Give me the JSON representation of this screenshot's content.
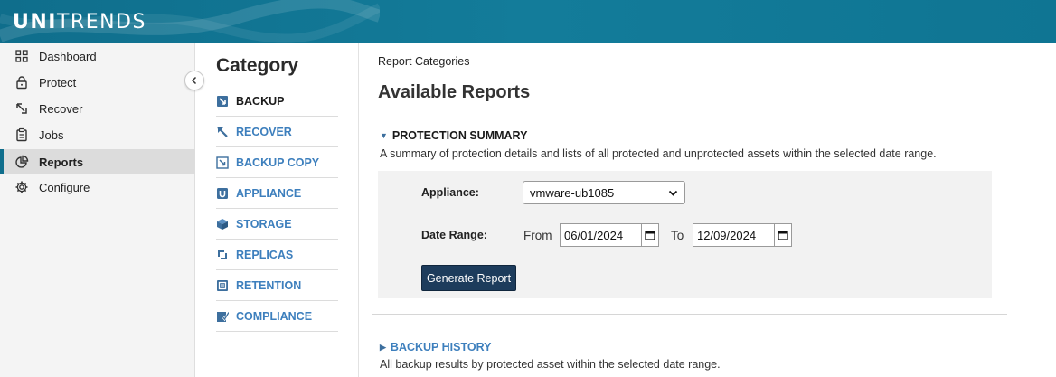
{
  "header": {
    "logo_strong": "UNI",
    "logo_rest": "TRENDS"
  },
  "sidebar": {
    "items": [
      {
        "label": "Dashboard",
        "icon": "dashboard-icon"
      },
      {
        "label": "Protect",
        "icon": "lock-icon"
      },
      {
        "label": "Recover",
        "icon": "recover-arrow-icon"
      },
      {
        "label": "Jobs",
        "icon": "clipboard-icon"
      },
      {
        "label": "Reports",
        "icon": "pie-chart-icon",
        "active": true
      },
      {
        "label": "Configure",
        "icon": "gear-icon"
      }
    ]
  },
  "category": {
    "title": "Category",
    "items": [
      {
        "label": "BACKUP",
        "icon": "backup-icon",
        "active": true
      },
      {
        "label": "RECOVER",
        "icon": "recover-icon"
      },
      {
        "label": "BACKUP COPY",
        "icon": "backup-copy-icon"
      },
      {
        "label": "APPLIANCE",
        "icon": "appliance-icon"
      },
      {
        "label": "STORAGE",
        "icon": "storage-cube-icon"
      },
      {
        "label": "REPLICAS",
        "icon": "replicas-icon"
      },
      {
        "label": "RETENTION",
        "icon": "retention-icon"
      },
      {
        "label": "COMPLIANCE",
        "icon": "compliance-icon"
      }
    ]
  },
  "main": {
    "breadcrumb": "Report Categories",
    "title": "Available Reports",
    "protection_summary": {
      "heading": "PROTECTION SUMMARY",
      "description": "A summary of protection details and lists of all protected and unprotected assets within the selected date range.",
      "appliance_label": "Appliance:",
      "appliance_value": "vmware-ub1085",
      "date_range_label": "Date Range:",
      "from_label": "From",
      "from_value": "06/01/2024",
      "to_label": "To",
      "to_value": "12/09/2024",
      "generate_button": "Generate Report"
    },
    "backup_history": {
      "heading": "BACKUP HISTORY",
      "description": "All backup results by protected asset within the selected date range."
    }
  },
  "colors": {
    "header": "#0f6e8c",
    "link": "#3d7fbd",
    "button": "#1d3c5c"
  }
}
